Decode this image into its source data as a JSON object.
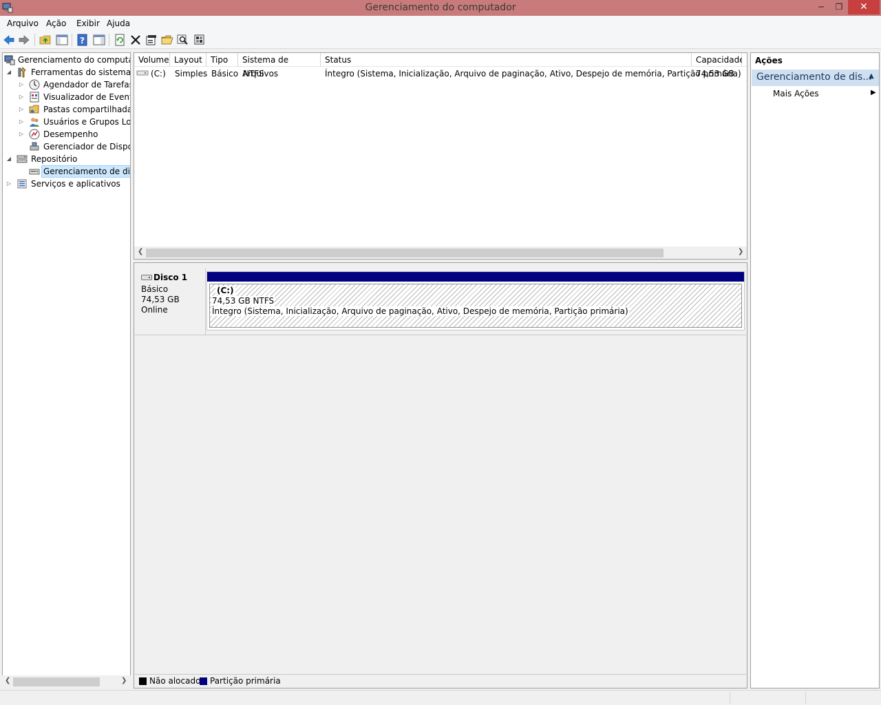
{
  "window": {
    "title": "Gerenciamento do computador",
    "min": "─",
    "max": "❐",
    "close": "✕"
  },
  "menu": [
    "Arquivo",
    "Ação",
    "Exibir",
    "Ajuda"
  ],
  "toolbar": {
    "icons": [
      "back-icon",
      "forward-icon",
      "up-folder-icon",
      "show-hide-tree-icon",
      "help-icon",
      "show-hide-action-pane-icon",
      "refresh-icon",
      "delete-icon",
      "properties-icon",
      "open-icon",
      "search-icon",
      "settings-icon"
    ]
  },
  "tree": {
    "root": "Gerenciamento do computado",
    "system_tools": "Ferramentas do sistema",
    "task_scheduler": "Agendador de Tarefas",
    "event_viewer": "Visualizador de Eventos",
    "shared_folders": "Pastas compartilhadas",
    "local_users": "Usuários e Grupos Loca",
    "performance": "Desempenho",
    "device_manager": "Gerenciador de Disposit",
    "storage": "Repositório",
    "disk_management": "Gerenciamento de disco",
    "services": "Serviços e aplicativos"
  },
  "volumes": {
    "headers": [
      "Volume",
      "Layout",
      "Tipo",
      "Sistema de Arquivos",
      "Status",
      "Capacidade"
    ],
    "rows": [
      {
        "volume": "(C:)",
        "layout": "Simples",
        "type": "Básico",
        "fs": "NTFS",
        "status": "Íntegro (Sistema, Inicialização, Arquivo de paginação, Ativo, Despejo de memória, Partição primária)",
        "capacity": "74,53 GB"
      }
    ]
  },
  "disk": {
    "name": "Disco 1",
    "kind": "Básico",
    "size": "74,53 GB",
    "state": "Online",
    "partition": {
      "label": "(C:)",
      "size_fs": "74,53 GB NTFS",
      "status": "Íntegro (Sistema, Inicialização, Arquivo de paginação, Ativo, Despejo de memória, Partição primária)"
    }
  },
  "legend": [
    {
      "label": "Não alocado",
      "color": "#000000"
    },
    {
      "label": "Partição primária",
      "color": "#000080"
    }
  ],
  "actions": {
    "header": "Ações",
    "section": "Gerenciamento de dis...",
    "more": "Mais Ações"
  },
  "colors": {
    "title_bar": "#c97a7a",
    "partition_bar": "#000080",
    "actions_section": "#cfe0f1"
  }
}
